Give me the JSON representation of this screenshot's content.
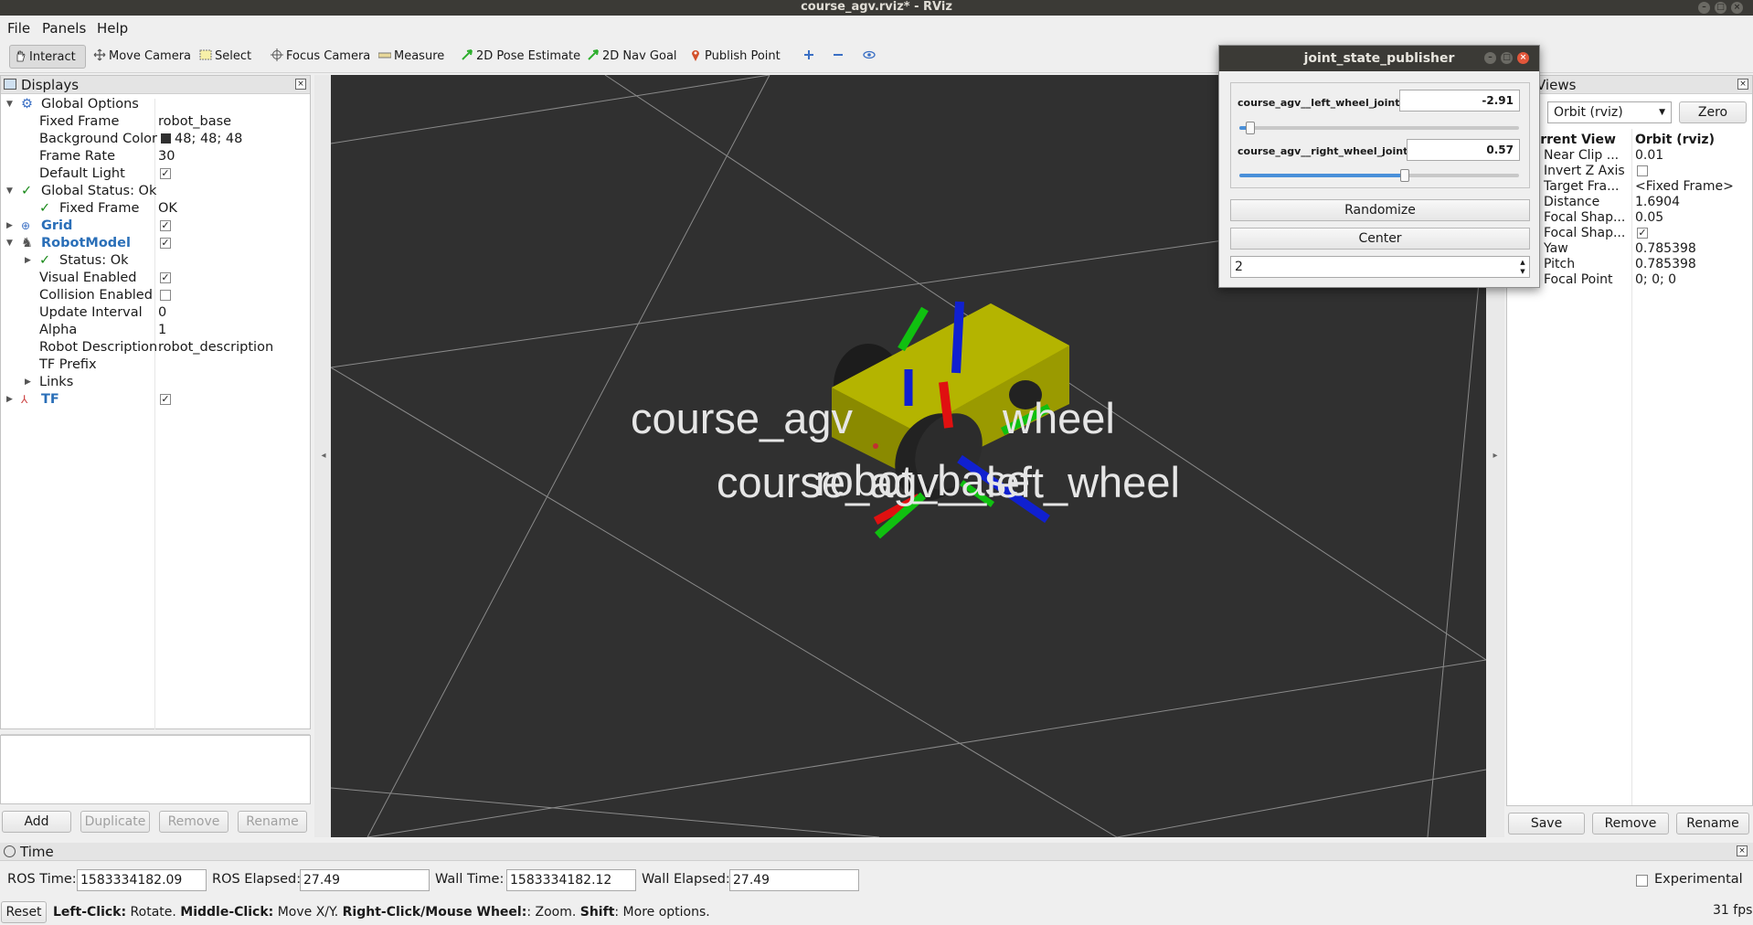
{
  "window": {
    "title": "course_agv.rviz* - RViz"
  },
  "menu": [
    "File",
    "Panels",
    "Help"
  ],
  "toolbar": {
    "tools": [
      "Interact",
      "Move Camera",
      "Select",
      "Focus Camera",
      "Measure",
      "2D Pose Estimate",
      "2D Nav Goal",
      "Publish Point"
    ],
    "extra_icons": [
      "plus-icon",
      "minus-icon",
      "eye-icon"
    ]
  },
  "displays": {
    "title": "Displays",
    "rows": [
      {
        "label": "Global Options",
        "value": ""
      },
      {
        "label": "Fixed Frame",
        "value": "robot_base"
      },
      {
        "label": "Background Color",
        "value": "48; 48; 48"
      },
      {
        "label": "Frame Rate",
        "value": "30"
      },
      {
        "label": "Default Light",
        "value": ""
      },
      {
        "label": "Global Status: Ok",
        "value": ""
      },
      {
        "label": "Fixed Frame",
        "value": "OK"
      },
      {
        "label": "Grid",
        "value": ""
      },
      {
        "label": "RobotModel",
        "value": ""
      },
      {
        "label": "Status: Ok",
        "value": ""
      },
      {
        "label": "Visual Enabled",
        "value": ""
      },
      {
        "label": "Collision Enabled",
        "value": ""
      },
      {
        "label": "Update Interval",
        "value": "0"
      },
      {
        "label": "Alpha",
        "value": "1"
      },
      {
        "label": "Robot Description",
        "value": "robot_description"
      },
      {
        "label": "TF Prefix",
        "value": ""
      },
      {
        "label": "Links",
        "value": ""
      },
      {
        "label": "TF",
        "value": ""
      }
    ],
    "buttons": [
      "Add",
      "Duplicate",
      "Remove",
      "Rename"
    ]
  },
  "render": {
    "frame_labels": [
      "course_agv",
      "wheel",
      "course_agv__left_wheel",
      "robot_base"
    ],
    "colors": {
      "background": "#303030",
      "body": "#a8a800",
      "x_axis": "#e01010",
      "y_axis": "#10c010",
      "z_axis": "#1020d0"
    }
  },
  "views": {
    "title": "Views",
    "type_value": "Orbit (rviz)",
    "zero_label": "Zero",
    "current_view_label": "Current View",
    "current_view_value": "Orbit (rviz)",
    "rows": [
      {
        "label": "Near Clip ...",
        "value": "0.01"
      },
      {
        "label": "Invert Z Axis",
        "value": ""
      },
      {
        "label": "Target Fra...",
        "value": "<Fixed Frame>"
      },
      {
        "label": "Distance",
        "value": "1.6904"
      },
      {
        "label": "Focal Shap...",
        "value": "0.05"
      },
      {
        "label": "Focal Shap...",
        "value": ""
      },
      {
        "label": "Yaw",
        "value": "0.785398"
      },
      {
        "label": "Pitch",
        "value": "0.785398"
      },
      {
        "label": "Focal Point",
        "value": "0; 0; 0"
      }
    ],
    "buttons": [
      "Save",
      "Remove",
      "Rename"
    ]
  },
  "time": {
    "title": "Time",
    "ros_time_label": "ROS Time:",
    "ros_time": "1583334182.09",
    "ros_elapsed_label": "ROS Elapsed:",
    "ros_elapsed": "27.49",
    "wall_time_label": "Wall Time:",
    "wall_time": "1583334182.12",
    "wall_elapsed_label": "Wall Elapsed:",
    "wall_elapsed": "27.49",
    "experimental_label": "Experimental",
    "reset_label": "Reset",
    "hint_parts": [
      "Left-Click:",
      " Rotate. ",
      "Middle-Click:",
      " Move X/Y. ",
      "Right-Click/Mouse Wheel:",
      ": Zoom. ",
      "Shift",
      ": More options."
    ],
    "fps": "31 fps"
  },
  "jsp": {
    "title": "joint_state_publisher",
    "left_label": "course_agv__left_wheel_joint",
    "left_value": "-2.91",
    "left_position": 0.04,
    "right_label": "course_agv__right_wheel_joint",
    "right_value": "0.57",
    "right_position": 0.59,
    "randomize_label": "Randomize",
    "center_label": "Center",
    "spin_value": "2"
  }
}
